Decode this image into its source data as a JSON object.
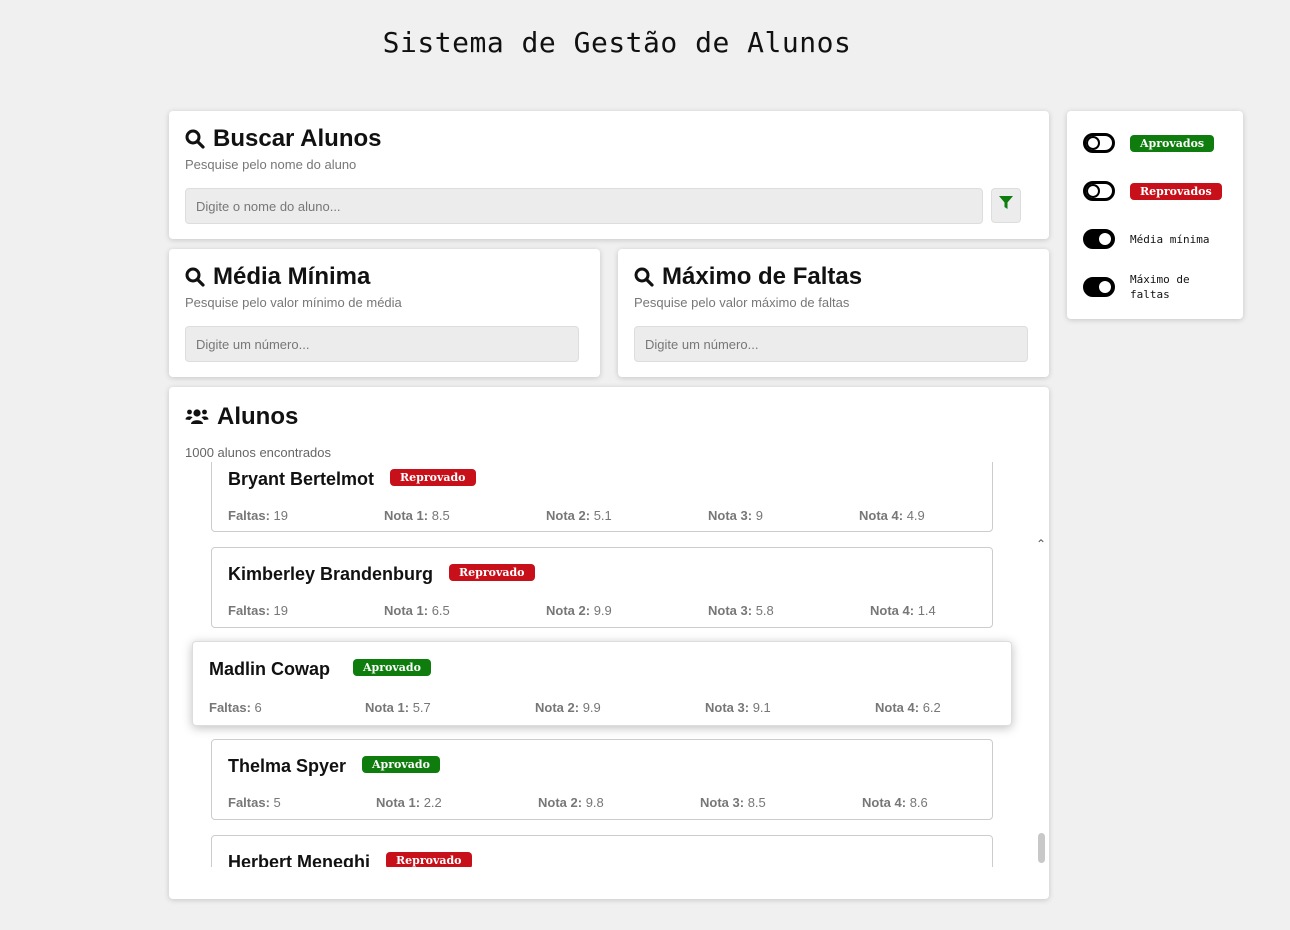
{
  "page_title": "Sistema de Gestão de Alunos",
  "search": {
    "title": "Buscar Alunos",
    "subtitle": "Pesquise pelo nome do aluno",
    "placeholder": "Digite o nome do aluno..."
  },
  "media": {
    "title": "Média Mínima",
    "subtitle": "Pesquise pelo valor mínimo de média",
    "placeholder": "Digite um número..."
  },
  "faltas": {
    "title": "Máximo de Faltas",
    "subtitle": "Pesquise pelo valor máximo de faltas",
    "placeholder": "Digite um número..."
  },
  "toggles": [
    {
      "label": "Aprovados",
      "state": "off"
    },
    {
      "label": "Reprovados",
      "state": "off"
    },
    {
      "label": "Média mínima",
      "state": "on"
    },
    {
      "label": "Máximo de faltas",
      "state": "on"
    }
  ],
  "alunos": {
    "title": "Alunos",
    "count_text": "1000 alunos encontrados",
    "labels": {
      "faltas": "Faltas:",
      "nota1": "Nota 1:",
      "nota2": "Nota 2:",
      "nota3": "Nota 3:",
      "nota4": "Nota 4:"
    },
    "students": [
      {
        "name": "Bryant Bertelmot",
        "status": "Reprovado",
        "faltas": "19",
        "nota1": "8.5",
        "nota2": "5.1",
        "nota3": "9",
        "nota4": "4.9"
      },
      {
        "name": "Kimberley Brandenburg",
        "status": "Reprovado",
        "faltas": "19",
        "nota1": "6.5",
        "nota2": "9.9",
        "nota3": "5.8",
        "nota4": "1.4"
      },
      {
        "name": "Madlin Cowap",
        "status": "Aprovado",
        "faltas": "6",
        "nota1": "5.7",
        "nota2": "9.9",
        "nota3": "9.1",
        "nota4": "6.2"
      },
      {
        "name": "Thelma Spyer",
        "status": "Aprovado",
        "faltas": "5",
        "nota1": "2.2",
        "nota2": "9.8",
        "nota3": "8.5",
        "nota4": "8.6"
      },
      {
        "name": "Herbert Meneghi",
        "status": "Reprovado",
        "faltas": "",
        "nota1": "",
        "nota2": "",
        "nota3": "",
        "nota4": ""
      }
    ]
  },
  "colors": {
    "aprovado": "#0e7d0e",
    "reprovado": "#c8101a"
  },
  "icons": {
    "search": "search-icon",
    "filter": "filter-icon",
    "users": "users-icon"
  }
}
